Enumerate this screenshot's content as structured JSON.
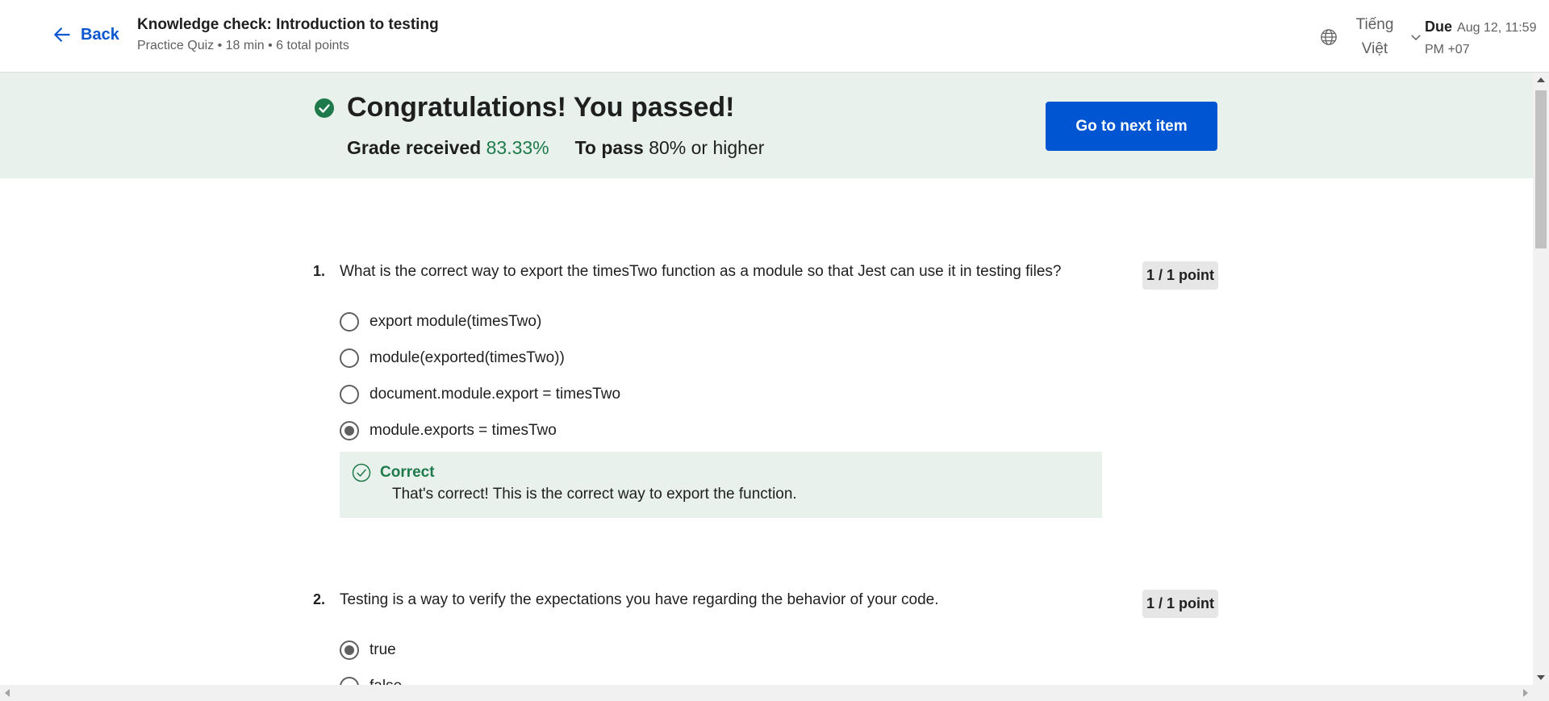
{
  "header": {
    "back_label": "Back",
    "title": "Knowledge check: Introduction to testing",
    "subtitle": "Practice Quiz • 18 min • 6 total points",
    "language_line1": "Tiếng",
    "language_line2": "Việt",
    "due_label": "Due",
    "due_date_line1": "Aug 12, 11:59",
    "due_date_line2": "PM +07"
  },
  "banner": {
    "title": "Congratulations! You passed!",
    "grade_label": "Grade received",
    "grade_value": "83.33%",
    "pass_label": "To pass",
    "pass_value": "80%",
    "pass_suffix": "or higher",
    "next_button": "Go to next item"
  },
  "questions": [
    {
      "number": "1.",
      "text": "What is the correct way to export the  timesTwo  function as a module so that Jest can use it in testing files?",
      "points": "1 / 1 point",
      "options": [
        {
          "label": "export module(timesTwo)",
          "selected": false
        },
        {
          "label": "module(exported(timesTwo))",
          "selected": false
        },
        {
          "label": "document.module.export = timesTwo",
          "selected": false
        },
        {
          "label": "module.exports = timesTwo",
          "selected": true
        }
      ],
      "feedback": {
        "title": "Correct",
        "text": "That's correct! This is the correct way to export the function."
      }
    },
    {
      "number": "2.",
      "text": "Testing is a way to verify the expectations you have regarding the behavior of your code.",
      "points": "1 / 1 point",
      "options": [
        {
          "label": "true",
          "selected": true
        },
        {
          "label": "false",
          "selected": false
        }
      ]
    }
  ],
  "colors": {
    "accent": "#0056d2",
    "success": "#1e7a4a",
    "banner_bg": "#e8f1ec"
  },
  "icons": [
    "arrow-left-icon",
    "globe-icon",
    "chevron-down-icon",
    "check-circle-filled-icon",
    "check-circle-outline-icon"
  ]
}
